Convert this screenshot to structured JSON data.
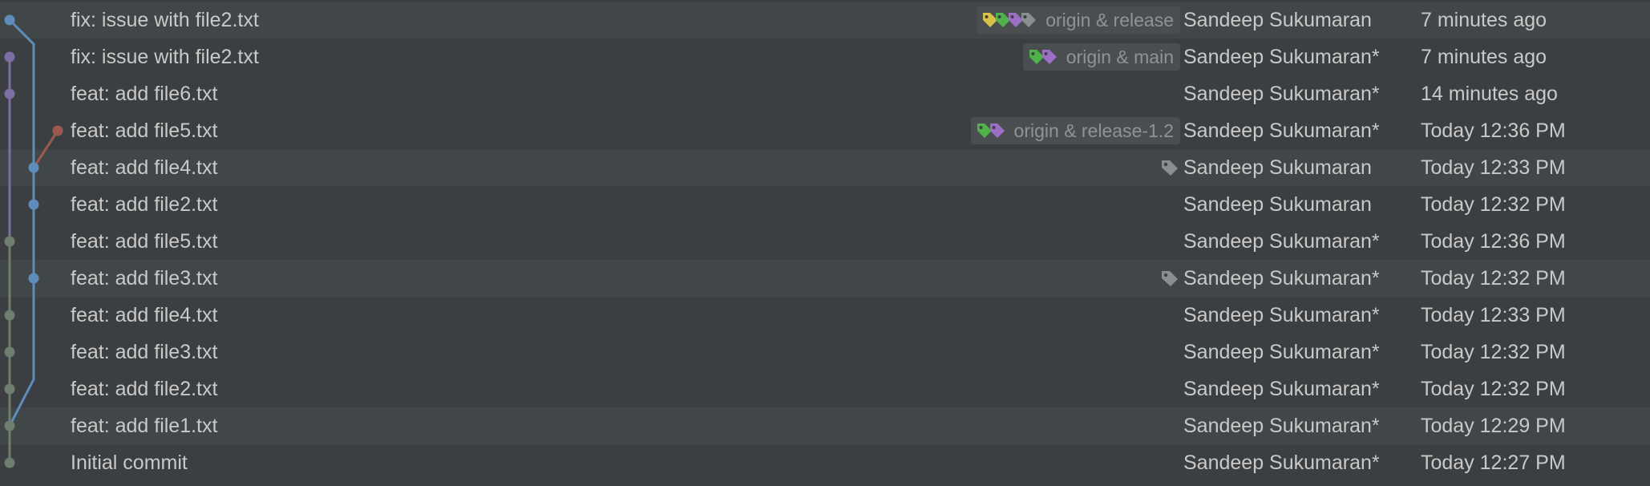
{
  "colors": {
    "background": "#3c3f41",
    "row_shade": "#414648",
    "branch_blue": "#5f8cba",
    "branch_purple": "#7c6ea6",
    "branch_grey": "#6f7e6e",
    "branch_red": "#9c5a4e",
    "tag_yellow": "#d8c04a",
    "tag_green": "#4fb24a",
    "tag_purple": "#9a6fc4",
    "tag_grey": "#8a8e91"
  },
  "commits": [
    {
      "message": "fix: issue with file2.txt",
      "author": "Sandeep Sukumaran",
      "date": "7 minutes ago",
      "refs": {
        "label": "origin & release",
        "tags": [
          "yellow",
          "green",
          "purple",
          "grey"
        ]
      },
      "tag_icon": false
    },
    {
      "message": "fix: issue with file2.txt",
      "author": "Sandeep Sukumaran*",
      "date": "7 minutes ago",
      "refs": {
        "label": "origin & main",
        "tags": [
          "green",
          "purple"
        ]
      },
      "tag_icon": false
    },
    {
      "message": "feat: add file6.txt",
      "author": "Sandeep Sukumaran*",
      "date": "14 minutes ago",
      "refs": null,
      "tag_icon": false
    },
    {
      "message": "feat: add file5.txt",
      "author": "Sandeep Sukumaran*",
      "date": "Today 12:36 PM",
      "refs": {
        "label": "origin & release-1.2",
        "tags": [
          "green",
          "purple"
        ]
      },
      "tag_icon": false
    },
    {
      "message": "feat: add file4.txt",
      "author": "Sandeep Sukumaran",
      "date": "Today 12:33 PM",
      "refs": null,
      "tag_icon": true
    },
    {
      "message": "feat: add file2.txt",
      "author": "Sandeep Sukumaran",
      "date": "Today 12:32 PM",
      "refs": null,
      "tag_icon": false
    },
    {
      "message": "feat: add file5.txt",
      "author": "Sandeep Sukumaran*",
      "date": "Today 12:36 PM",
      "refs": null,
      "tag_icon": false
    },
    {
      "message": "feat: add file3.txt",
      "author": "Sandeep Sukumaran*",
      "date": "Today 12:32 PM",
      "refs": null,
      "tag_icon": true
    },
    {
      "message": "feat: add file4.txt",
      "author": "Sandeep Sukumaran*",
      "date": "Today 12:33 PM",
      "refs": null,
      "tag_icon": false
    },
    {
      "message": "feat: add file3.txt",
      "author": "Sandeep Sukumaran*",
      "date": "Today 12:32 PM",
      "refs": null,
      "tag_icon": false
    },
    {
      "message": "feat: add file2.txt",
      "author": "Sandeep Sukumaran*",
      "date": "Today 12:32 PM",
      "refs": null,
      "tag_icon": false
    },
    {
      "message": "feat: add file1.txt",
      "author": "Sandeep Sukumaran*",
      "date": "Today 12:29 PM",
      "refs": null,
      "tag_icon": false
    },
    {
      "message": "Initial commit",
      "author": "Sandeep Sukumaran*",
      "date": "Today 12:27 PM",
      "refs": null,
      "tag_icon": false
    }
  ]
}
